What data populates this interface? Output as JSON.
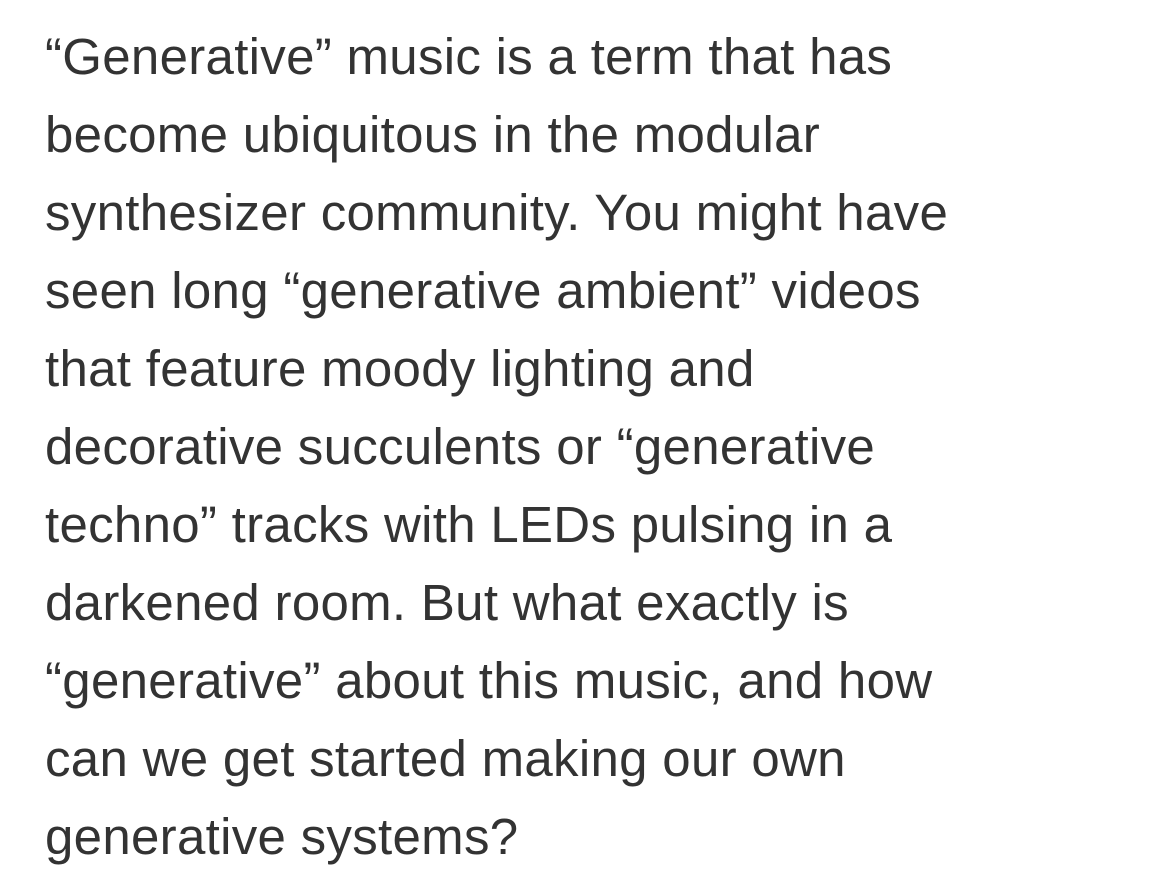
{
  "article": {
    "lines": [
      "“Generative” music is a term that has",
      "become ubiquitous in the modular",
      "synthesizer community. You might have",
      "seen long “generative ambient” videos",
      "that feature moody lighting and",
      "decorative succulents or “generative",
      "techno” tracks with LEDs pulsing in a",
      "darkened room. But what exactly is",
      "“generative” about this music, and how",
      "can we get started making our own",
      "generative systems?"
    ]
  }
}
